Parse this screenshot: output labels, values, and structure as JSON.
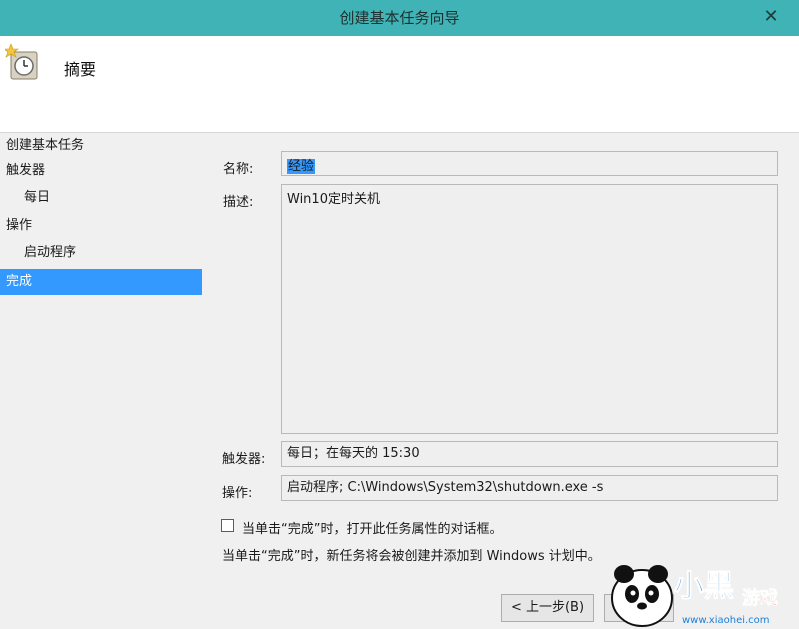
{
  "window": {
    "title": "创建基本任务向导",
    "close_glyph": "✕"
  },
  "header": {
    "title": "摘要"
  },
  "nav": {
    "items": [
      {
        "label": "创建基本任务"
      },
      {
        "label": "触发器"
      },
      {
        "label": "每日"
      },
      {
        "label": "操作"
      },
      {
        "label": "启动程序"
      },
      {
        "label": "完成"
      }
    ]
  },
  "form": {
    "name_label": "名称:",
    "name_value": "经验",
    "desc_label": "描述:",
    "desc_value": "Win10定时关机",
    "trigger_label": "触发器:",
    "trigger_value": "每日；在每天的 15:30",
    "action_label": "操作:",
    "action_value": "启动程序; C:\\Windows\\System32\\shutdown.exe -s",
    "checkbox_label": "当单击“完成”时，打开此任务属性的对话框。",
    "info_text": "当单击“完成”时，新任务将会被创建并添加到 Windows 计划中。"
  },
  "buttons": {
    "back": "< 上一步(B)"
  },
  "watermark": {
    "brand": "小黑",
    "brand2": "游戏",
    "url": "www.xiaohei.com"
  }
}
